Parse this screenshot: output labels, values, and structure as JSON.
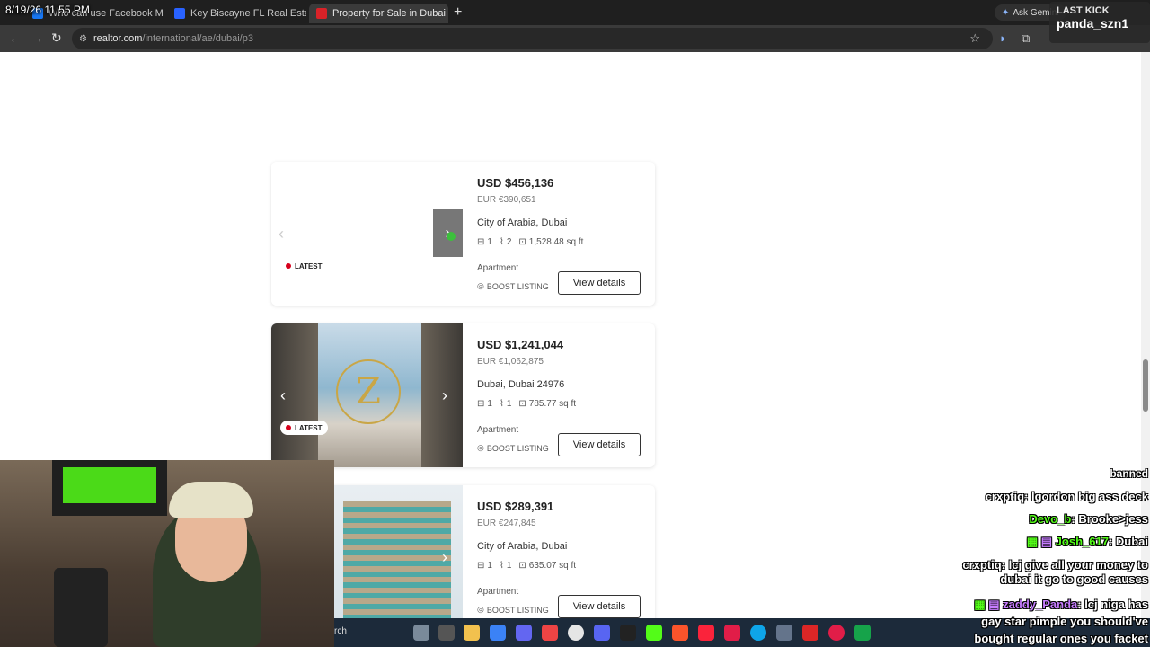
{
  "overlay": {
    "clock": "8/19/26 11:55 PM",
    "last_kick_label": "LAST KICK",
    "last_kick_user": "panda_szn1"
  },
  "browser": {
    "tabs": [
      {
        "label": "Who can use Facebook Marketp",
        "active": false,
        "color": "#1877f2"
      },
      {
        "label": "Key Biscayne FL Real Estate - Ke",
        "active": false,
        "color": "#2962ff"
      },
      {
        "label": "Property for Sale in Dubai - rea",
        "active": true,
        "color": "#d92228"
      }
    ],
    "gemini_label": "Ask Gemini",
    "url_host": "realtor.com",
    "url_path": "/international/ae/dubai/p3"
  },
  "listings": [
    {
      "price": "USD $456,136",
      "eur": "EUR €390,651",
      "location": "City of Arabia, Dubai",
      "beds": "1",
      "baths": "2",
      "size": "1,528.48 sq ft",
      "type": "Apartment",
      "boost": "BOOST LISTING",
      "cta": "View details",
      "badge": "LATEST"
    },
    {
      "price": "USD $1,241,044",
      "eur": "EUR €1,062,875",
      "location": "Dubai, Dubai 24976",
      "beds": "1",
      "baths": "1",
      "size": "785.77 sq ft",
      "type": "Apartment",
      "boost": "BOOST LISTING",
      "cta": "View details",
      "badge": "LATEST"
    },
    {
      "price": "USD $289,391",
      "eur": "EUR €247,845",
      "location": "City of Arabia, Dubai",
      "beds": "1",
      "baths": "1",
      "size": "635.07 sq ft",
      "type": "Apartment",
      "boost": "BOOST LISTING",
      "cta": "View details"
    }
  ],
  "taskbar": {
    "search_text": "rch"
  },
  "chat": [
    {
      "user": "",
      "text": "banned",
      "color": "#ffffff"
    },
    {
      "user": "crxptiq",
      "text": ": lgordon big ass deck",
      "color": "#ffffff"
    },
    {
      "user": "Devo_b",
      "text": ": Brooke>jess",
      "color": "#53fc18"
    },
    {
      "user": "Josh_617",
      "text": ": Dubai",
      "color": "#53fc18"
    },
    {
      "user": "crxptiq",
      "text": ": lcj give all your money to",
      "color": "#ffffff"
    },
    {
      "user": "",
      "text": "dubai it go to good causes",
      "color": "#ffffff"
    },
    {
      "user": "zaddy_Panda",
      "text": ": lcj niga has",
      "color": "#c77dff"
    },
    {
      "user": "",
      "text": "gay star pimple you should've",
      "color": "#ffffff"
    },
    {
      "user": "",
      "text": "bought regular ones you facket",
      "color": "#ffffff"
    }
  ]
}
